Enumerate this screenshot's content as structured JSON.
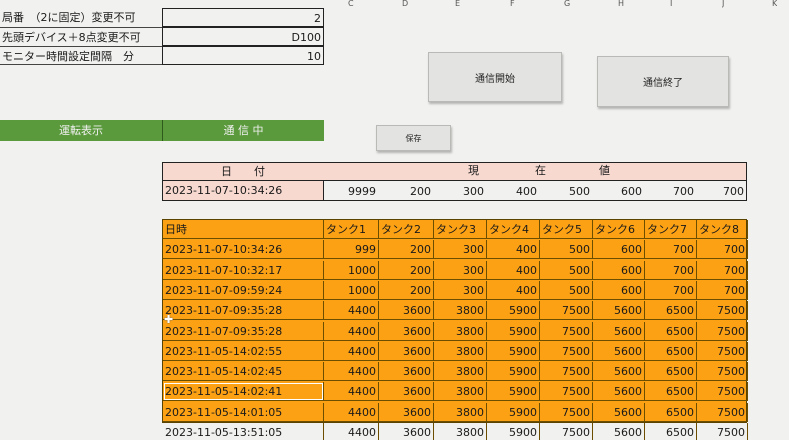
{
  "columns": [
    "C",
    "D",
    "E",
    "F",
    "G",
    "H",
    "I",
    "J",
    "K"
  ],
  "settings": [
    {
      "label": "局番　（2に固定）変更不可",
      "value": "2"
    },
    {
      "label": "先頭デバイス＋8点変更不可",
      "value": "D100"
    },
    {
      "label": "モニター時間設定間隔　分",
      "value": "10"
    }
  ],
  "buttons": {
    "start": "通信開始",
    "stop": "通信終了",
    "save": "保存"
  },
  "status": {
    "label": "運転表示",
    "value": "通 信 中"
  },
  "current": {
    "date_header": "日　　付",
    "value_header": [
      "現",
      "在",
      "値"
    ],
    "date": "2023-11-07-10:34:26",
    "values": [
      "9999",
      "200",
      "300",
      "400",
      "500",
      "600",
      "700",
      "700"
    ]
  },
  "log": {
    "headers": [
      "日時",
      "タンク1",
      "タンク2",
      "タンク3",
      "タンク4",
      "タンク5",
      "タンク6",
      "タンク7",
      "タンク8"
    ],
    "rows": [
      [
        "2023-11-07-10:34:26",
        "999",
        "200",
        "300",
        "400",
        "500",
        "600",
        "700",
        "700"
      ],
      [
        "2023-11-07-10:32:17",
        "1000",
        "200",
        "300",
        "400",
        "500",
        "600",
        "700",
        "700"
      ],
      [
        "2023-11-07-09:59:24",
        "1000",
        "200",
        "300",
        "400",
        "500",
        "600",
        "700",
        "700"
      ],
      [
        "2023-11-07-09:35:28",
        "4400",
        "3600",
        "3800",
        "5900",
        "7500",
        "5600",
        "6500",
        "7500"
      ],
      [
        "2023-11-07-09:35:28",
        "4400",
        "3600",
        "3800",
        "5900",
        "7500",
        "5600",
        "6500",
        "7500"
      ],
      [
        "2023-11-05-14:02:55",
        "4400",
        "3600",
        "3800",
        "5900",
        "7500",
        "5600",
        "6500",
        "7500"
      ],
      [
        "2023-11-05-14:02:45",
        "4400",
        "3600",
        "3800",
        "5900",
        "7500",
        "5600",
        "6500",
        "7500"
      ],
      [
        "2023-11-05-14:02:41",
        "4400",
        "3600",
        "3800",
        "5900",
        "7500",
        "5600",
        "6500",
        "7500"
      ],
      [
        "2023-11-05-14:01:05",
        "4400",
        "3600",
        "3800",
        "5900",
        "7500",
        "5600",
        "6500",
        "7500"
      ],
      [
        "2023-11-05-13:51:05",
        "4400",
        "3600",
        "3800",
        "5900",
        "7500",
        "5600",
        "6500",
        "7500"
      ]
    ]
  }
}
